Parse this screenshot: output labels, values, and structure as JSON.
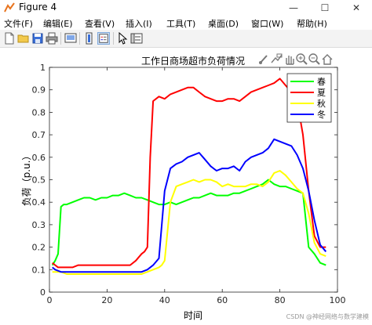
{
  "window": {
    "title": "Figure 4",
    "minimize": "—",
    "maximize": "☐",
    "close": "✕"
  },
  "menu": [
    "文件(F)",
    "编辑(E)",
    "查看(V)",
    "插入(I)",
    "工具(T)",
    "桌面(D)",
    "窗口(W)",
    "帮助(H)"
  ],
  "toolbar_icons": [
    "new-file-icon",
    "open-folder-icon",
    "save-icon",
    "print-icon",
    "link-plot-icon",
    "colorbar-icon",
    "legend-icon",
    "pointer-icon",
    "property-inspector-icon"
  ],
  "axes_toolbar_icons": [
    "brush-icon",
    "datatip-icon",
    "pan-icon",
    "zoom-in-icon",
    "zoom-out-icon",
    "home-icon"
  ],
  "watermark": "CSDN @神经网络与数学建模",
  "chart_data": {
    "type": "line",
    "title": "工作日商场超市负荷情况",
    "xlabel": "时间",
    "ylabel": "负荷（p.u.）",
    "xlim": [
      0,
      100
    ],
    "ylim": [
      0,
      1
    ],
    "xticks": [
      "0",
      "20",
      "40",
      "60",
      "80",
      "100"
    ],
    "yticks": [
      "0",
      "0.1",
      "0.2",
      "0.3",
      "0.4",
      "0.5",
      "0.6",
      "0.7",
      "0.8",
      "0.9",
      "1"
    ],
    "grid": false,
    "legend_position": "top-right",
    "series": [
      {
        "name": "春",
        "color": "#00ff00",
        "x": [
          1,
          2,
          3,
          4,
          5,
          6,
          8,
          10,
          12,
          14,
          16,
          18,
          20,
          22,
          24,
          26,
          28,
          30,
          32,
          34,
          36,
          38,
          40,
          42,
          44,
          46,
          48,
          50,
          52,
          54,
          56,
          58,
          60,
          62,
          64,
          66,
          68,
          70,
          72,
          74,
          76,
          78,
          80,
          82,
          84,
          86,
          88,
          90,
          92,
          94,
          96
        ],
        "y": [
          0.12,
          0.14,
          0.17,
          0.38,
          0.39,
          0.39,
          0.4,
          0.41,
          0.42,
          0.42,
          0.41,
          0.42,
          0.42,
          0.43,
          0.43,
          0.44,
          0.43,
          0.42,
          0.42,
          0.41,
          0.4,
          0.39,
          0.39,
          0.4,
          0.39,
          0.4,
          0.41,
          0.42,
          0.42,
          0.43,
          0.44,
          0.43,
          0.43,
          0.43,
          0.44,
          0.44,
          0.45,
          0.46,
          0.47,
          0.48,
          0.5,
          0.48,
          0.47,
          0.47,
          0.46,
          0.45,
          0.44,
          0.2,
          0.17,
          0.13,
          0.12
        ]
      },
      {
        "name": "夏",
        "color": "#ff0000",
        "x": [
          1,
          2,
          3,
          4,
          6,
          8,
          10,
          12,
          14,
          16,
          18,
          20,
          22,
          24,
          26,
          28,
          30,
          32,
          33,
          34,
          35,
          36,
          38,
          40,
          42,
          44,
          46,
          48,
          50,
          52,
          54,
          56,
          58,
          60,
          62,
          64,
          66,
          68,
          70,
          72,
          74,
          76,
          78,
          80,
          82,
          84,
          86,
          88,
          90,
          92,
          94,
          96
        ],
        "y": [
          0.13,
          0.12,
          0.11,
          0.11,
          0.11,
          0.11,
          0.12,
          0.12,
          0.12,
          0.12,
          0.12,
          0.12,
          0.12,
          0.12,
          0.12,
          0.12,
          0.14,
          0.17,
          0.18,
          0.2,
          0.6,
          0.85,
          0.87,
          0.86,
          0.88,
          0.89,
          0.9,
          0.91,
          0.91,
          0.89,
          0.87,
          0.86,
          0.85,
          0.85,
          0.86,
          0.86,
          0.85,
          0.87,
          0.89,
          0.9,
          0.91,
          0.92,
          0.93,
          0.95,
          0.92,
          0.89,
          0.85,
          0.7,
          0.45,
          0.25,
          0.2,
          0.2
        ]
      },
      {
        "name": "秋",
        "color": "#ffff00",
        "x": [
          1,
          2,
          4,
          6,
          8,
          10,
          12,
          14,
          16,
          18,
          20,
          22,
          24,
          26,
          28,
          30,
          32,
          34,
          36,
          38,
          39,
          40,
          42,
          44,
          46,
          48,
          50,
          52,
          54,
          56,
          58,
          60,
          62,
          64,
          66,
          68,
          70,
          72,
          74,
          76,
          78,
          80,
          82,
          84,
          86,
          88,
          90,
          92,
          94,
          96
        ],
        "y": [
          0.09,
          0.09,
          0.09,
          0.08,
          0.08,
          0.08,
          0.08,
          0.08,
          0.08,
          0.08,
          0.08,
          0.08,
          0.08,
          0.08,
          0.08,
          0.08,
          0.08,
          0.09,
          0.1,
          0.11,
          0.12,
          0.14,
          0.4,
          0.47,
          0.48,
          0.49,
          0.5,
          0.49,
          0.5,
          0.5,
          0.49,
          0.47,
          0.48,
          0.47,
          0.47,
          0.47,
          0.48,
          0.48,
          0.47,
          0.49,
          0.53,
          0.54,
          0.52,
          0.49,
          0.46,
          0.44,
          0.35,
          0.22,
          0.17,
          0.16
        ]
      },
      {
        "name": "冬",
        "color": "#0000ff",
        "x": [
          1,
          2,
          4,
          6,
          8,
          10,
          12,
          14,
          16,
          18,
          20,
          22,
          24,
          26,
          28,
          30,
          32,
          34,
          36,
          38,
          40,
          42,
          44,
          46,
          48,
          50,
          52,
          54,
          56,
          58,
          60,
          62,
          64,
          66,
          68,
          70,
          72,
          74,
          76,
          78,
          80,
          82,
          84,
          86,
          88,
          90,
          92,
          94,
          96
        ],
        "y": [
          0.11,
          0.1,
          0.09,
          0.09,
          0.09,
          0.09,
          0.09,
          0.09,
          0.09,
          0.09,
          0.09,
          0.09,
          0.09,
          0.09,
          0.09,
          0.09,
          0.09,
          0.1,
          0.12,
          0.15,
          0.45,
          0.55,
          0.57,
          0.58,
          0.6,
          0.61,
          0.62,
          0.59,
          0.56,
          0.54,
          0.55,
          0.55,
          0.56,
          0.54,
          0.58,
          0.6,
          0.61,
          0.62,
          0.64,
          0.68,
          0.67,
          0.66,
          0.65,
          0.61,
          0.55,
          0.45,
          0.32,
          0.21,
          0.18
        ]
      }
    ]
  }
}
